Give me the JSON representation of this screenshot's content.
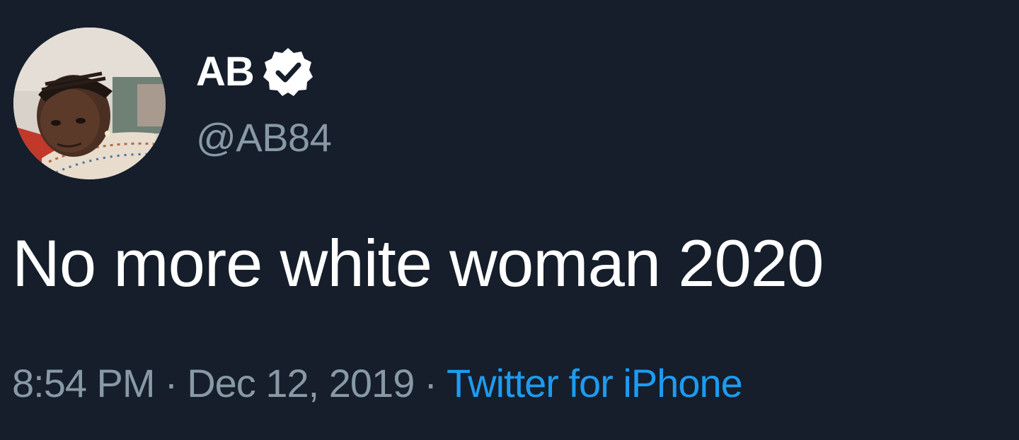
{
  "user": {
    "display_name": "AB",
    "handle": "@AB84",
    "verified": true,
    "avatar_icon": "profile-photo"
  },
  "tweet": {
    "text": "No more white woman 2020",
    "time": "8:54 PM",
    "date": "Dec 12, 2019",
    "separator": "·",
    "source": "Twitter for iPhone"
  },
  "colors": {
    "background": "#151e2a",
    "text_primary": "#ffffff",
    "text_secondary": "#8899a6",
    "link": "#1d9bf0"
  }
}
